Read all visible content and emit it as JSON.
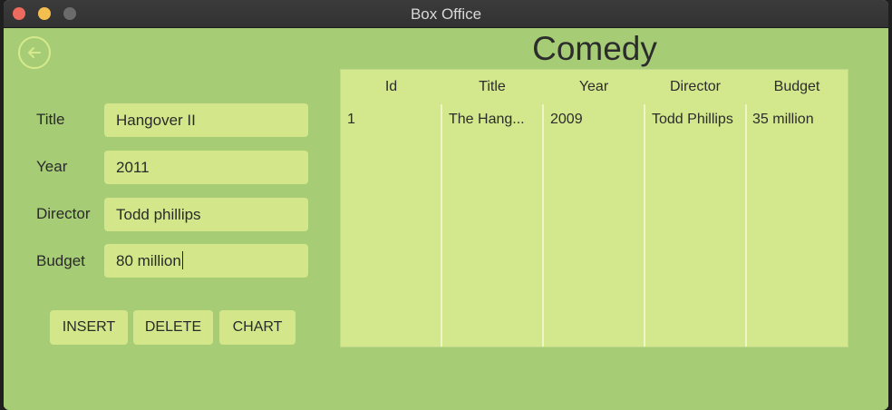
{
  "window": {
    "title": "Box Office"
  },
  "page": {
    "title": "Comedy"
  },
  "form": {
    "title_label": "Title",
    "title_value": "Hangover II",
    "year_label": "Year",
    "year_value": "2011",
    "director_label": "Director",
    "director_value": "Todd phillips",
    "budget_label": "Budget",
    "budget_value": "80 million"
  },
  "buttons": {
    "insert": "INSERT",
    "delete": "DELETE",
    "chart": "CHART"
  },
  "table": {
    "columns": [
      "Id",
      "Title",
      "Year",
      "Director",
      "Budget"
    ],
    "rows": [
      [
        "1",
        "The Hang...",
        "2009",
        "Todd Phillips",
        "35 million"
      ]
    ]
  },
  "colors": {
    "background": "#a6cd76",
    "field": "#d3e78a",
    "table": "#d3e88c"
  },
  "icons": {
    "back": "back-arrow-icon"
  }
}
